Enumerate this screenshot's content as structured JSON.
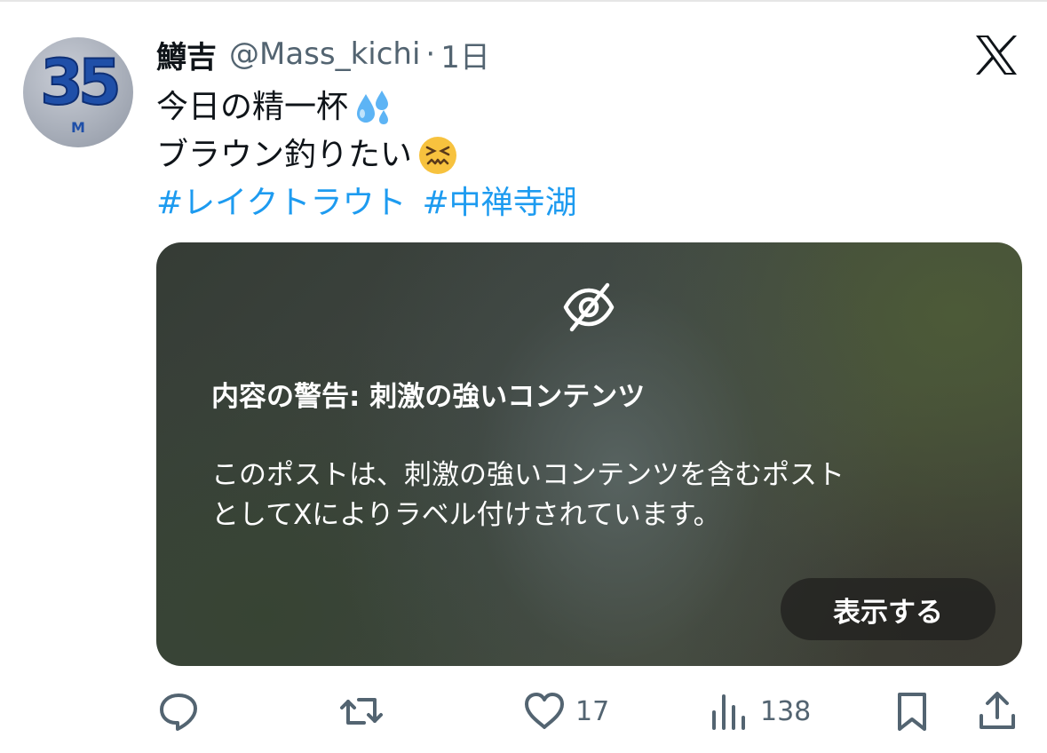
{
  "user": {
    "name": "鱒吉",
    "handle": "@Mass_kichi",
    "separator": "·",
    "time": "1日",
    "avatar_number": "35",
    "avatar_letter": "M"
  },
  "tweet": {
    "line1": "今日の精一杯",
    "line2": "ブラウン釣りたい",
    "hashtags": [
      "#レイクトラウト",
      "#中禅寺湖"
    ]
  },
  "warning": {
    "title": "内容の警告: 刺激の強いコンテンツ",
    "body_line1": "このポストは、刺激の強いコンテンツを含むポスト",
    "body_line2": "としてXによりラベル付けされています。",
    "show_label": "表示する"
  },
  "actions": {
    "likes": "17",
    "views": "138"
  },
  "icons": {
    "platform": "x-logo-icon",
    "hidden": "eye-slash-icon",
    "reply": "reply-icon",
    "repost": "repost-icon",
    "like": "heart-icon",
    "views": "views-icon",
    "bookmark": "bookmark-icon",
    "share": "share-icon"
  },
  "colors": {
    "link": "#1d9bf0",
    "secondary_text": "#536471",
    "primary_text": "#0f1419"
  }
}
